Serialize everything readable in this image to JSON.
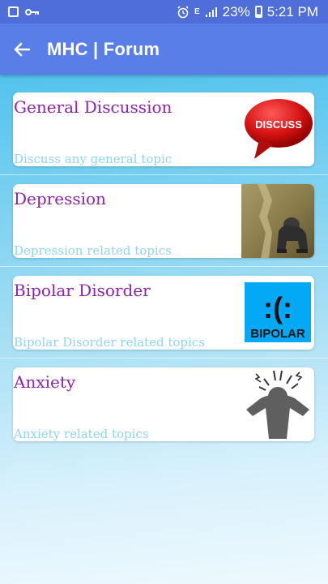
{
  "status_bar": {
    "battery": "23%",
    "time": "5:21 PM",
    "network": "E"
  },
  "app_bar": {
    "title": "MHC | Forum",
    "back_icon": "arrow-left-icon"
  },
  "colors": {
    "status_bar": "#4f6ed8",
    "app_bar": "#5a7ee8",
    "title_text": "#8e24aa",
    "subtitle_text": "#8fd5f1"
  },
  "forum_topics": [
    {
      "title": "General Discussion",
      "subtitle": "Discuss any general topic",
      "image": "discuss-speech-bubble",
      "image_text": "DISCUSS"
    },
    {
      "title": "Depression",
      "subtitle": "Depression related topics",
      "image": "depressed-person-photo"
    },
    {
      "title": "Bipolar Disorder",
      "subtitle": "Bipolar Disorder related topics",
      "image": "bipolar-faces-logo",
      "image_text": "BIPOLAR",
      "image_faces": ":(:"
    },
    {
      "title": "Anxiety",
      "subtitle": "Anxiety related topics",
      "image": "anxious-person-icon"
    }
  ]
}
